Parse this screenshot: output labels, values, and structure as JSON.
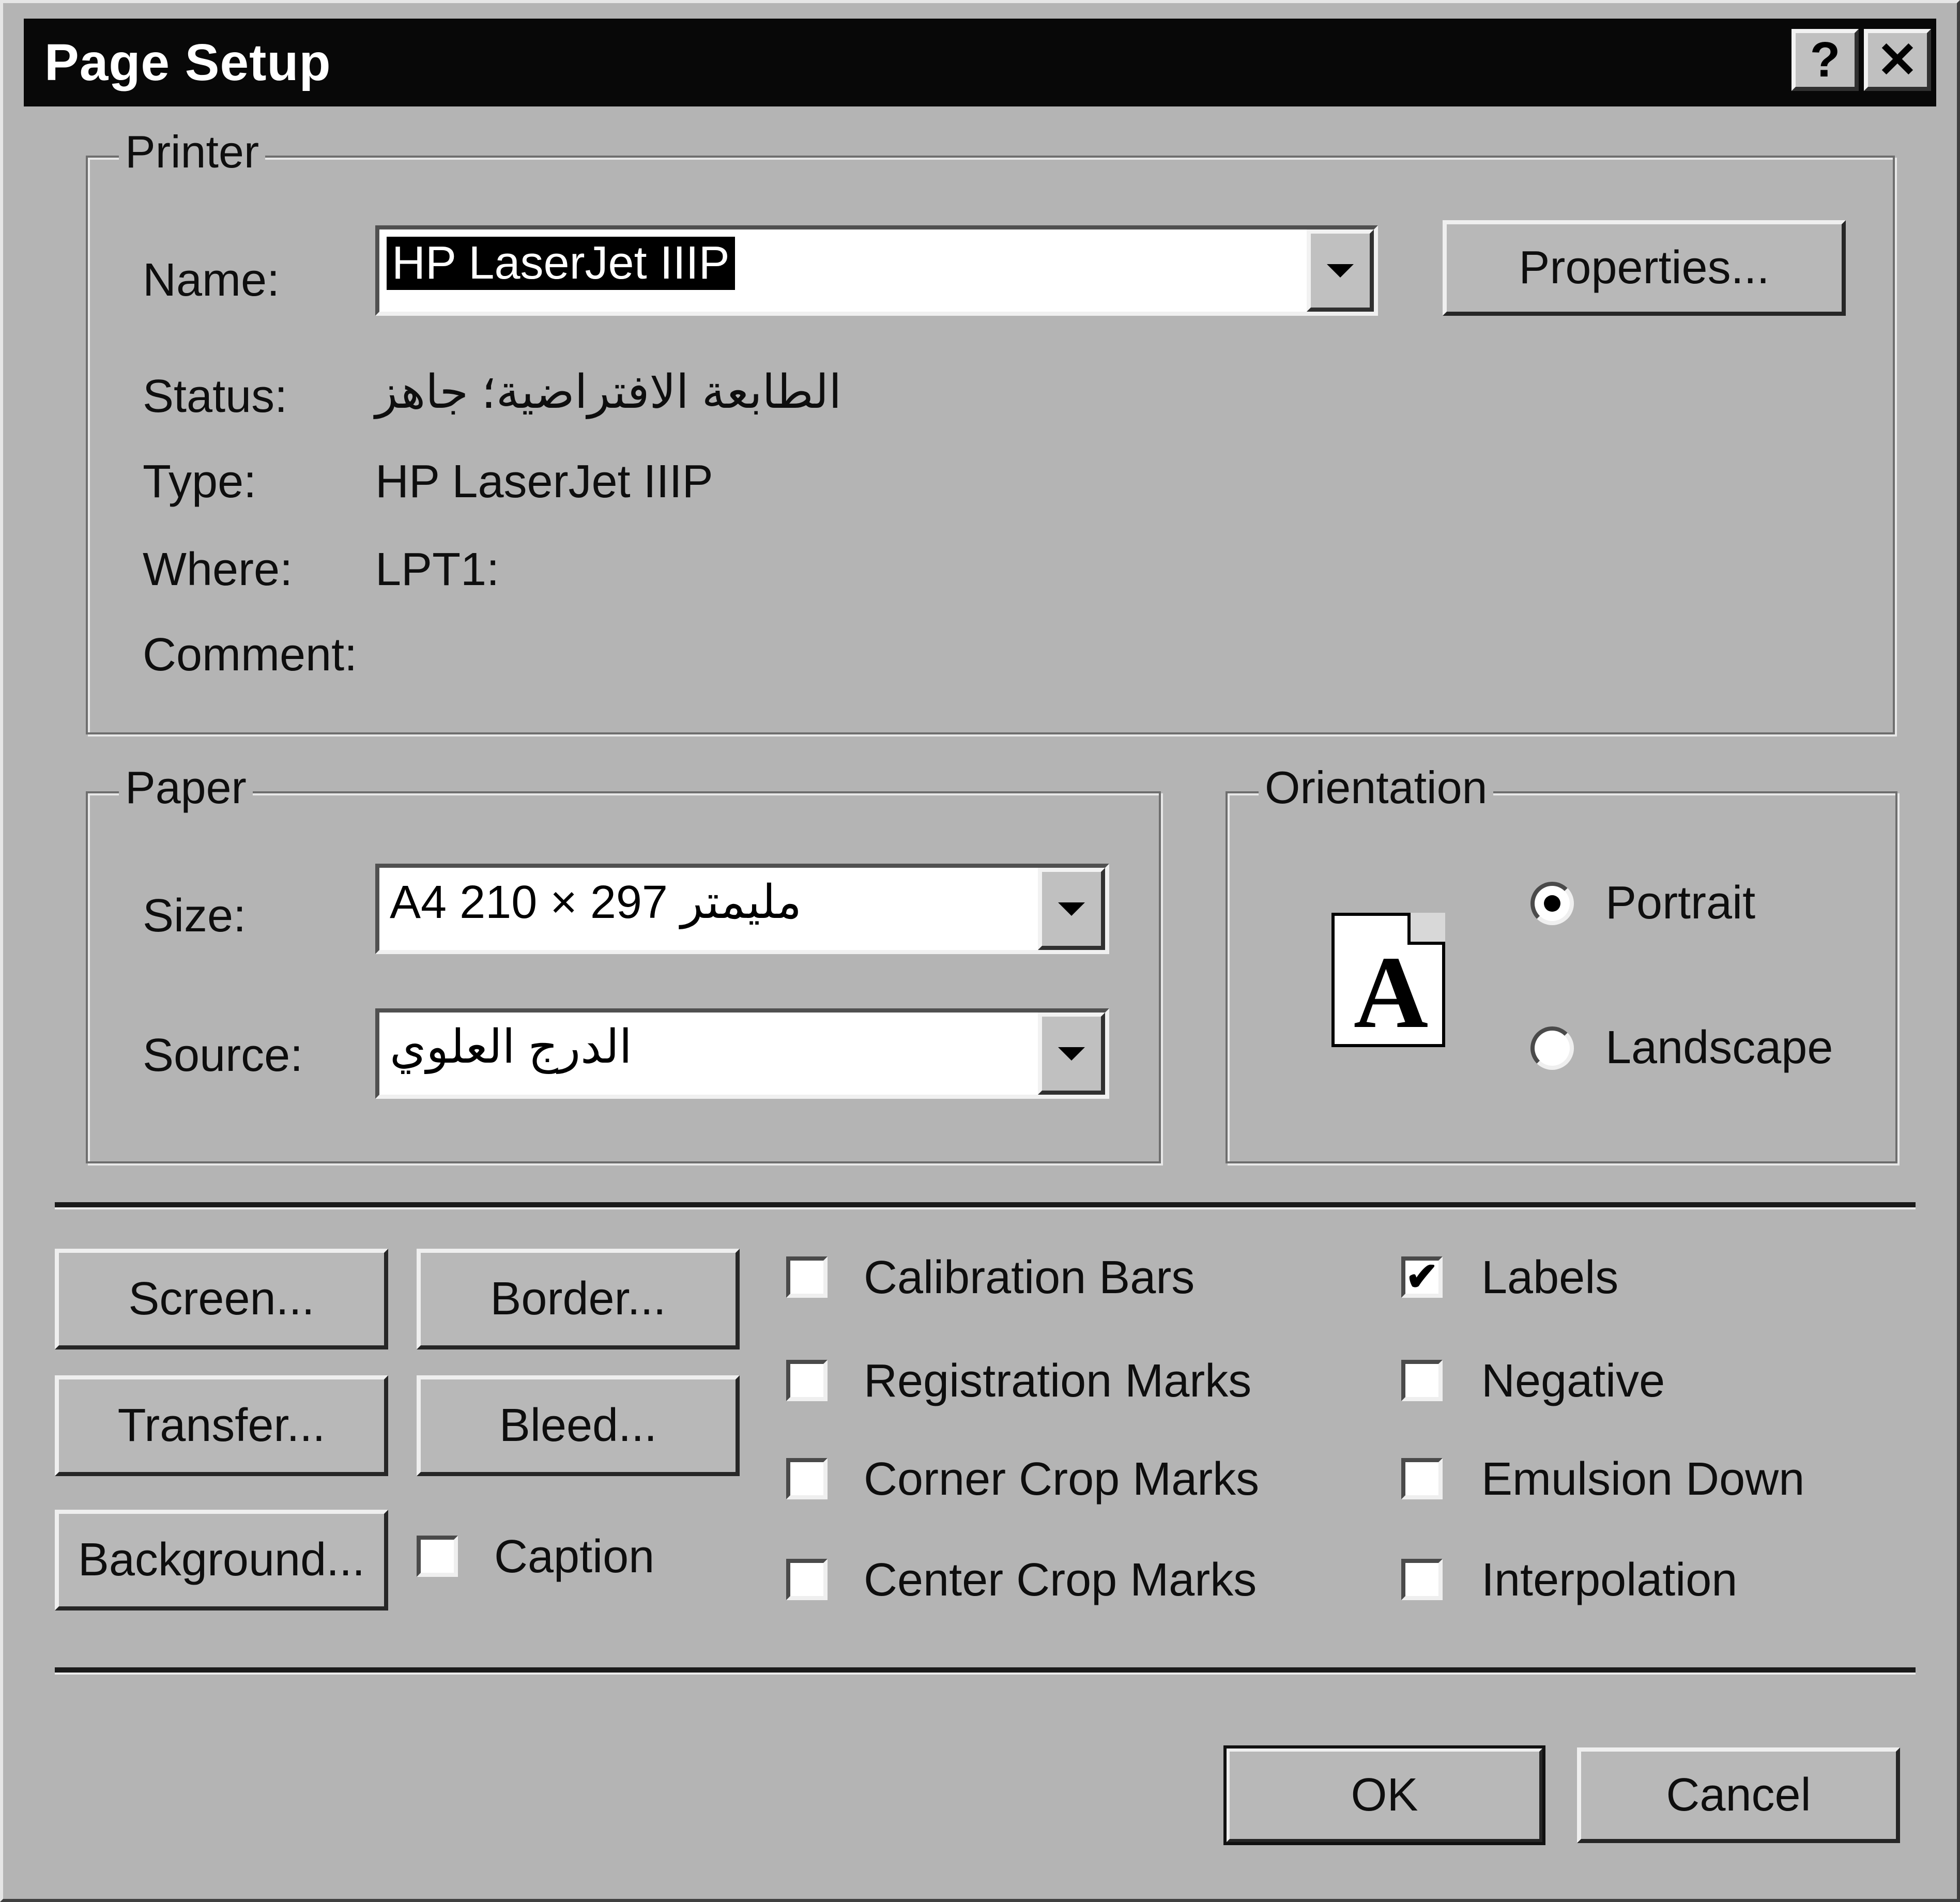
{
  "window": {
    "title": "Page Setup",
    "help_label": "?",
    "close_label": "✕"
  },
  "printer": {
    "legend": "Printer",
    "name_label": "Name:",
    "name_value": "HP LaserJet IIIP",
    "properties_label": "Properties...",
    "status_label": "Status:",
    "status_value": "الطابعة الافتراضية؛ جاهز",
    "type_label": "Type:",
    "type_value": "HP LaserJet IIIP",
    "where_label": "Where:",
    "where_value": "LPT1:",
    "comment_label": "Comment:",
    "comment_value": ""
  },
  "paper": {
    "legend": "Paper",
    "size_label": "Size:",
    "size_value": "A4 210 × 297 مليمتر",
    "source_label": "Source:",
    "source_value": "الدرج العلوي"
  },
  "orientation": {
    "legend": "Orientation",
    "icon_letter": "A",
    "portrait_label": "Portrait",
    "landscape_label": "Landscape",
    "selected": "Portrait"
  },
  "buttons": {
    "screen": "Screen...",
    "border": "Border...",
    "transfer": "Transfer...",
    "bleed": "Bleed...",
    "background": "Background...",
    "ok": "OK",
    "cancel": "Cancel"
  },
  "checkboxes": {
    "caption": {
      "label": "Caption",
      "checked": false
    },
    "calibration_bars": {
      "label": "Calibration Bars",
      "checked": false
    },
    "registration_marks": {
      "label": "Registration Marks",
      "checked": false
    },
    "corner_crop_marks": {
      "label": "Corner Crop Marks",
      "checked": false
    },
    "center_crop_marks": {
      "label": "Center Crop Marks",
      "checked": false
    },
    "labels": {
      "label": "Labels",
      "checked": true
    },
    "negative": {
      "label": "Negative",
      "checked": false
    },
    "emulsion_down": {
      "label": "Emulsion Down",
      "checked": false
    },
    "interpolation": {
      "label": "Interpolation",
      "checked": false
    }
  },
  "check_mark": "✔"
}
